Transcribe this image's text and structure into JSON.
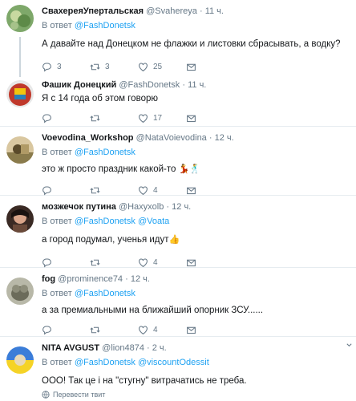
{
  "tweets": [
    {
      "name": "СвахереяУпертальская",
      "handle": "@Svahereya",
      "time": "11 ч.",
      "reply_label": "В ответ",
      "reply_mentions": [
        "@FashDonetsk"
      ],
      "text": "А давайте над Донецком не флажки и листовки сбрасывать, а водку?",
      "emoji": "",
      "replies": "3",
      "retweets": "3",
      "likes": "25"
    },
    {
      "name": "Фашик Донецкий",
      "handle": "@FashDonetsk",
      "time": "11 ч.",
      "reply_label": "",
      "reply_mentions": [],
      "text": "Я с 14 года об этом говорю",
      "emoji": "",
      "replies": "",
      "retweets": "",
      "likes": "17"
    },
    {
      "name": "Voevodina_Workshop",
      "handle": "@NataVoievodina",
      "time": "12 ч.",
      "reply_label": "В ответ",
      "reply_mentions": [
        "@FashDonetsk"
      ],
      "text": "это ж просто праздник какой-то",
      "emoji": "💃🕺",
      "replies": "",
      "retweets": "",
      "likes": "4"
    },
    {
      "name": "мозжечок путина",
      "handle": "@Haxyxolb",
      "time": "12 ч.",
      "reply_label": "В ответ",
      "reply_mentions": [
        "@FashDonetsk",
        "@Voata"
      ],
      "text": "а город подумал, ученья идут",
      "emoji": "👍",
      "replies": "",
      "retweets": "",
      "likes": "4"
    },
    {
      "name": "fog",
      "handle": "@prominence74",
      "time": "12 ч.",
      "reply_label": "В ответ",
      "reply_mentions": [
        "@FashDonetsk"
      ],
      "text": "а за премиальными на ближайший опорник ЗСУ......",
      "emoji": "",
      "replies": "",
      "retweets": "",
      "likes": "4"
    },
    {
      "name": "NITA AVGUST",
      "handle": "@lion4874",
      "time": "2 ч.",
      "reply_label": "В ответ",
      "reply_mentions": [
        "@FashDonetsk",
        "@viscountOdessit"
      ],
      "text": "ООО! Так це і на \"стугну\" витрачатись не треба.",
      "emoji": "",
      "replies": "",
      "retweets": "",
      "likes": ""
    }
  ],
  "translate_label": "Перевести твит",
  "colors": {
    "accent": "#1da1f2",
    "muted": "#657786",
    "like": "#657786",
    "divider": "#e6ecf0"
  }
}
